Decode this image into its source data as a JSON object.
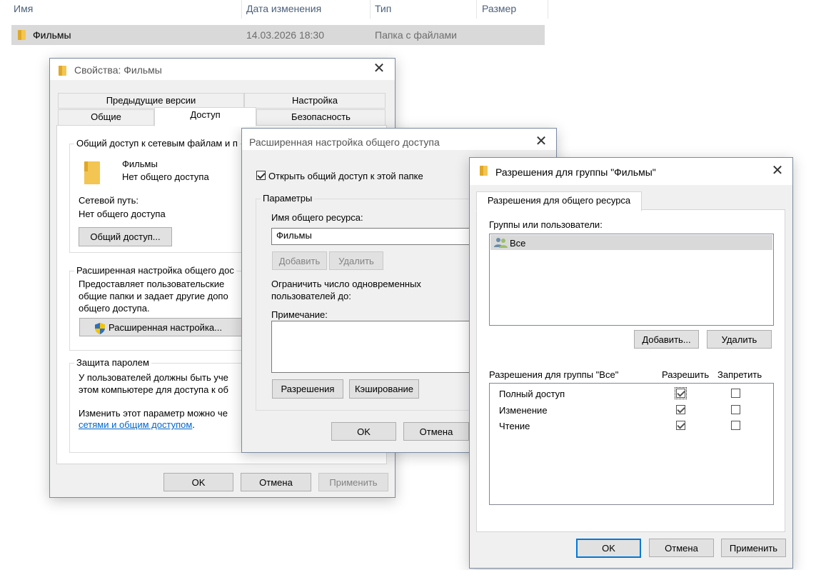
{
  "explorer": {
    "columns": [
      "Имя",
      "Дата изменения",
      "Тип",
      "Размер"
    ],
    "row": {
      "name": "Фильмы",
      "date": "14.03.2026 18:30",
      "type": "Папка с файлами"
    }
  },
  "properties": {
    "title": "Свойства: Фильмы",
    "tabs": {
      "previous_versions": "Предыдущие версии",
      "customize": "Настройка",
      "general": "Общие",
      "sharing": "Доступ",
      "security": "Безопасность"
    },
    "network_group": {
      "label": "Общий доступ к сетевым файлам и п",
      "folder_name": "Фильмы",
      "folder_status": "Нет общего доступа",
      "network_path_label": "Сетевой путь:",
      "network_path_value": "Нет общего доступа",
      "share_button": "Общий доступ..."
    },
    "advanced_group": {
      "label": "Расширенная настройка общего дос",
      "line1": "Предоставляет пользовательские",
      "line2": "общие папки и задает другие допо",
      "line3": "общего доступа.",
      "button": "Расширенная настройка..."
    },
    "password_group": {
      "label": "Защита паролем",
      "line1": "У пользователей должны быть уче",
      "line2": "этом компьютере для доступа к об",
      "line3": "Изменить этот параметр можно че",
      "link": "сетями и общим доступом",
      "link_suffix": "."
    },
    "buttons": {
      "ok": "OK",
      "cancel": "Отмена",
      "apply": "Применить"
    }
  },
  "advanced": {
    "title": "Расширенная настройка общего доступа",
    "share_checkbox": "Открыть общий доступ к этой папке",
    "share_checked": true,
    "params_label": "Параметры",
    "share_name_label": "Имя общего ресурса:",
    "share_name_value": "Фильмы",
    "add": "Добавить",
    "remove": "Удалить",
    "limit_line1": "Ограничить число одновременных",
    "limit_line2": "пользователей до:",
    "comment_label": "Примечание:",
    "permissions_button": "Разрешения",
    "caching_button": "Кэширование",
    "ok": "OK",
    "cancel": "Отмена"
  },
  "permissions": {
    "title": "Разрешения для группы \"Фильмы\"",
    "tab": "Разрешения для общего ресурса",
    "groups_label": "Группы или пользователи:",
    "group_item": "Все",
    "add": "Добавить...",
    "remove": "Удалить",
    "perm_header": "Разрешения для группы \"Все\"",
    "allow_header": "Разрешить",
    "deny_header": "Запретить",
    "rows": [
      {
        "name": "Полный доступ",
        "allow": true,
        "deny": false
      },
      {
        "name": "Изменение",
        "allow": true,
        "deny": false
      },
      {
        "name": "Чтение",
        "allow": true,
        "deny": false
      }
    ],
    "ok": "OK",
    "cancel": "Отмена",
    "apply": "Применить"
  }
}
